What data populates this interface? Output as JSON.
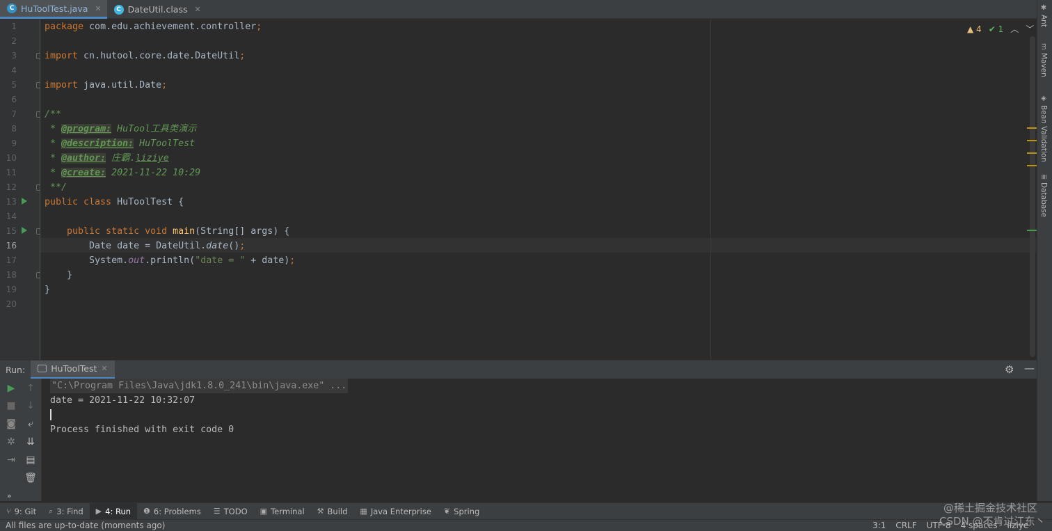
{
  "tabs": [
    {
      "label": "HuToolTest.java",
      "icon": "java-class-icon",
      "active": true
    },
    {
      "label": "DateUtil.class",
      "icon": "compiled-class-icon",
      "active": false
    }
  ],
  "editor": {
    "line_numbers": [
      "1",
      "2",
      "3",
      "4",
      "5",
      "6",
      "7",
      "8",
      "9",
      "10",
      "11",
      "12",
      "13",
      "14",
      "15",
      "16",
      "17",
      "18",
      "19",
      "20"
    ],
    "current_line": "16",
    "code": {
      "l1_kw": "package",
      "l1_rest": " com.edu.achievement.controller",
      "l1_semi": ";",
      "l3_kw": "import",
      "l3_rest": " cn.hutool.core.date.DateUtil",
      "l3_semi": ";",
      "l5_kw": "import",
      "l5_rest": " java.util.Date",
      "l5_semi": ";",
      "l7": "/**",
      "l8_pre": " * ",
      "l8_tag": "@program:",
      "l8_text": " HuTool工具类演示",
      "l9_pre": " * ",
      "l9_tag": "@description:",
      "l9_text": " HuToolTest",
      "l10_pre": " * ",
      "l10_tag": "@author:",
      "l10_text": " 庄霸.",
      "l10_und": "liziye",
      "l11_pre": " * ",
      "l11_tag": "@create:",
      "l11_text": " 2021-11-22 10:29",
      "l12": " **/",
      "l13_kw": "public class",
      "l13_rest": " HuToolTest {",
      "l15_kw": "    public static void",
      "l15_fn": " main",
      "l15_rest": "(String[] args) {",
      "l16_a": "        Date date = DateUtil.",
      "l16_call": "date",
      "l16_b": "()",
      "l16_semi": ";",
      "l17_a": "        System.",
      "l17_stat": "out",
      "l17_b": ".println(",
      "l17_str": "\"date = \"",
      "l17_c": " + date)",
      "l17_semi": ";",
      "l18": "    }",
      "l19": "}"
    }
  },
  "inspections": {
    "warnings": "4",
    "weak_warnings": "1"
  },
  "right_tools": [
    "Ant",
    "Maven",
    "Bean Validation",
    "Database"
  ],
  "run": {
    "label": "Run:",
    "tab": "HuToolTest",
    "console": [
      "\"C:\\Program Files\\Java\\jdk1.8.0_241\\bin\\java.exe\" ...",
      "date = 2021-11-22 10:32:07",
      "",
      "Process finished with exit code 0"
    ]
  },
  "tool_windows": [
    {
      "label": "9: Git",
      "icon": "git-branch-icon"
    },
    {
      "label": "3: Find",
      "icon": "search-icon"
    },
    {
      "label": "4: Run",
      "icon": "run-icon",
      "active": true
    },
    {
      "label": "6: Problems",
      "icon": "problems-icon"
    },
    {
      "label": "TODO",
      "icon": "todo-list-icon"
    },
    {
      "label": "Terminal",
      "icon": "terminal-icon"
    },
    {
      "label": "Build",
      "icon": "hammer-icon"
    },
    {
      "label": "Java Enterprise",
      "icon": "java-enterprise-icon"
    },
    {
      "label": "Spring",
      "icon": "spring-leaf-icon"
    }
  ],
  "status": {
    "message": "All files are up-to-date (moments ago)",
    "position": "3:1",
    "line_sep": "CRLF",
    "encoding": "UTF-8",
    "indent": "4 spaces",
    "user": "liziye"
  },
  "watermark": {
    "line1": "@稀土掘金技术社区",
    "line2": "CSDN @不肯过江东丶"
  }
}
